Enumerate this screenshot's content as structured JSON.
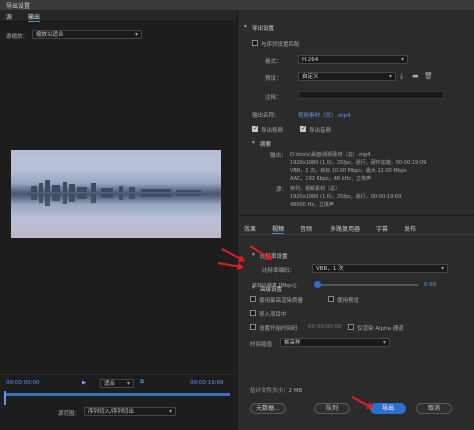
{
  "window": {
    "title": "导出设置"
  },
  "left": {
    "tabs": [
      "源",
      "输出"
    ],
    "source_scale_label": "源缩放：",
    "source_scale_value": "缩放以适合",
    "timecode_start": "00:00:00:00",
    "zoom": "适合",
    "timecode_end": "00:00:19:09",
    "source_range_label": "源范围：",
    "source_range_value": "序列切入/序列切出"
  },
  "export": {
    "section": "导出设置",
    "match_sequence": "与序列设置匹配",
    "format_label": "格式：",
    "format_value": "H.264",
    "preset_label": "预设：",
    "preset_value": "自定义",
    "comments_label": "注释：",
    "output_name_label": "输出名称：",
    "output_name_value": "视频素材（总）.mp4",
    "export_video": "导出视频",
    "export_audio": "导出音频"
  },
  "summary": {
    "title": "摘要",
    "output_label": "输出：",
    "output_lines": [
      "D:\\tools\\桌面\\视频素材（总）.mp4",
      "1920x1080 (1.0)，25fps，逐行，硬件加速，00:00:19:09",
      "VBR，1 次，目标 10.00 Mbps，最大 12.00 Mbps",
      "AAC，192 Kbps，48 kHz，立体声"
    ],
    "source_label": "源：",
    "source_lines": [
      "序列，视频素材（总）",
      "1920x1080 (1.0)，25fps，逐行，00:00:19:09",
      "48000 Hz，立体声"
    ]
  },
  "bottom_tabs": [
    "效果",
    "视频",
    "音频",
    "多路复用器",
    "字幕",
    "发布"
  ],
  "bitrate": {
    "section": "比特率设置",
    "encoding_label": "比特率编码：",
    "encoding_value": "VBR，1 次",
    "target_label": "目标比特率 [Mbps]：",
    "target_value": "0.69"
  },
  "advanced": {
    "section": "高级设置",
    "max_render_quality": "使用最高渲染质量",
    "use_previews": "使用预览",
    "import_into_project": "导入项目中",
    "set_start_timecode": "设置开始时间码",
    "start_timecode_value": "00:00:00:00",
    "render_alpha_only": "仅渲染 Alpha 通道",
    "time_interpolation_label": "时间插值",
    "time_interpolation_value": "帧采样",
    "estimated_size": "估计文件大小：2 MB",
    "metadata_button": "元数据...",
    "queue_button": "队列",
    "export_button": "导出",
    "cancel_button": "取消"
  }
}
